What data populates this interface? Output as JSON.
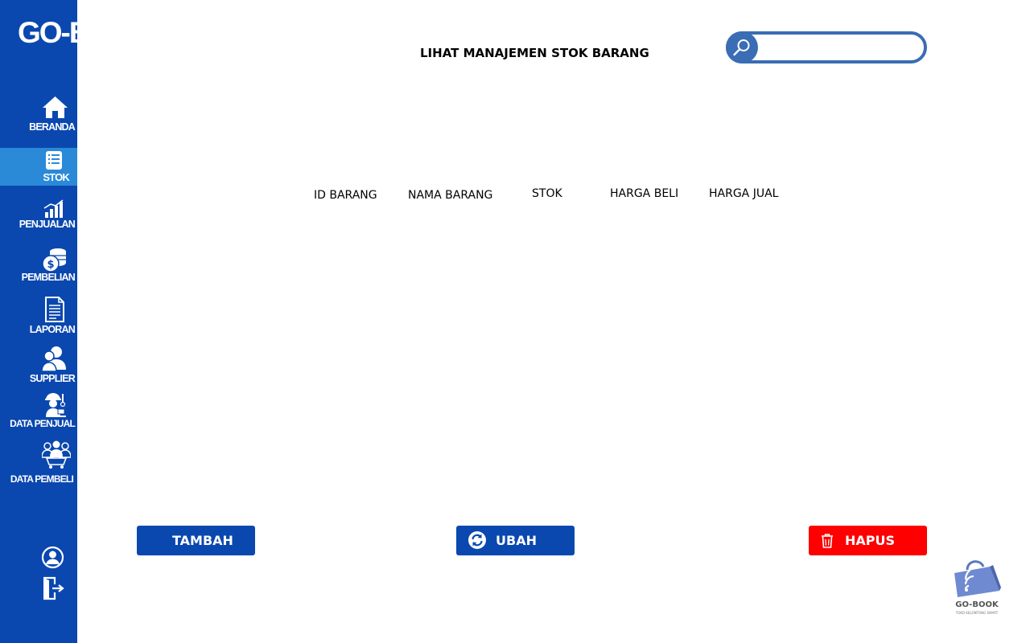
{
  "app": {
    "brand": "GO-BOOK",
    "page_title": "LIHAT MANAJEMEN STOK BARANG"
  },
  "sidebar": {
    "items": [
      {
        "label": "BERANDA",
        "icon": "home-icon"
      },
      {
        "label": "STOK",
        "icon": "list-icon",
        "active": true
      },
      {
        "label": "PENJUALAN",
        "icon": "bar-chart-icon"
      },
      {
        "label": "PEMBELIAN",
        "icon": "coins-icon"
      },
      {
        "label": "LAPORAN",
        "icon": "document-icon"
      },
      {
        "label": "SUPPLIER",
        "icon": "users-icon"
      },
      {
        "label": "DATA PENJUAL",
        "icon": "seller-icon"
      },
      {
        "label": "DATA PEMBELI",
        "icon": "buyers-icon"
      }
    ],
    "bottom_icons": [
      "profile-icon",
      "logout-icon"
    ]
  },
  "search": {
    "value": "",
    "placeholder": "",
    "icon": "search-icon"
  },
  "table": {
    "columns": [
      "ID BARANG",
      "NAMA BARANG",
      "STOK",
      "HARGA BELI",
      "HARGA JUAL"
    ],
    "rows": []
  },
  "actions": {
    "tambah": "TAMBAH",
    "ubah": "UBAH",
    "hapus": "HAPUS"
  },
  "logo": {
    "name": "GO-BOOK",
    "tagline": "TOKO KELONTONG SMART"
  },
  "colors": {
    "primary": "#0a48b0",
    "active": "#2a8ad8",
    "danger": "#ff0000",
    "search_border": "#3a6db4"
  }
}
